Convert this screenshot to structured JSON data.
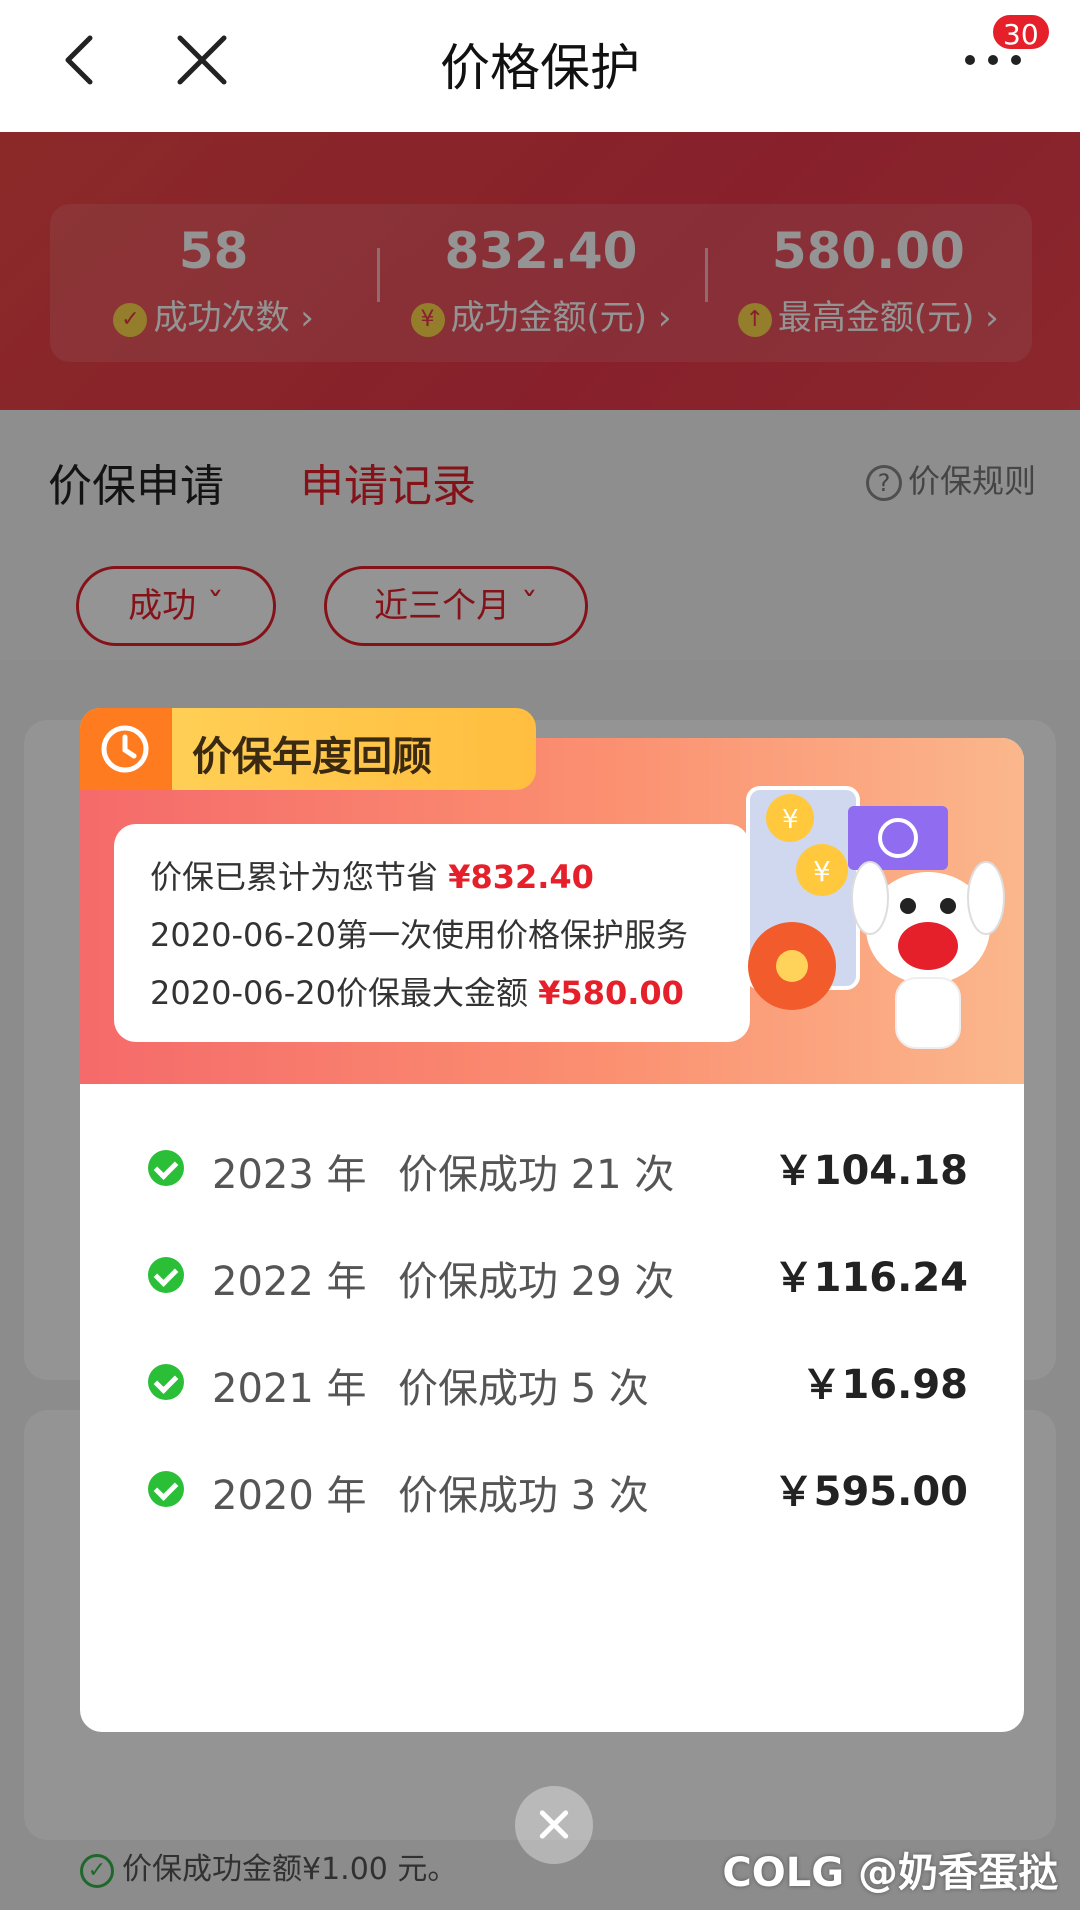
{
  "header": {
    "title": "价格保护",
    "badge": "30"
  },
  "stats": [
    {
      "value": "58",
      "label": "成功次数",
      "icon": "check-circle-icon"
    },
    {
      "value": "832.40",
      "label": "成功金额(元)",
      "icon": "yuan-icon"
    },
    {
      "value": "580.00",
      "label": "最高金额(元)",
      "icon": "arrow-up-icon"
    }
  ],
  "tabs": {
    "apply": "价保申请",
    "records": "申请记录",
    "rules": "价保规则"
  },
  "filters": {
    "status": "成功 ˇ",
    "range": "近三个月 ˇ"
  },
  "background": {
    "footer_text": "价保成功金额¥1.00 元。"
  },
  "modal": {
    "title": "价保年度回顾",
    "summary": {
      "line1_prefix": "价保已累计为您节省 ",
      "line1_amount": "¥832.40",
      "line2": "2020-06-20第一次使用价格保护服务",
      "line3_prefix": "2020-06-20价保最大金额 ",
      "line3_amount": "¥580.00"
    },
    "rows": [
      {
        "year": "2023 年",
        "count": "价保成功 21 次",
        "amount": "￥104.18"
      },
      {
        "year": "2022 年",
        "count": "价保成功 29 次",
        "amount": "￥116.24"
      },
      {
        "year": "2021 年",
        "count": "价保成功 5 次",
        "amount": "￥16.98"
      },
      {
        "year": "2020 年",
        "count": "价保成功 3 次",
        "amount": "￥595.00"
      }
    ]
  },
  "watermark": "COLG @奶香蛋挞",
  "colors": {
    "brand_red": "#e5202b",
    "success_green": "#2bbf38",
    "ribbon_yellow": "#ffd35a"
  }
}
